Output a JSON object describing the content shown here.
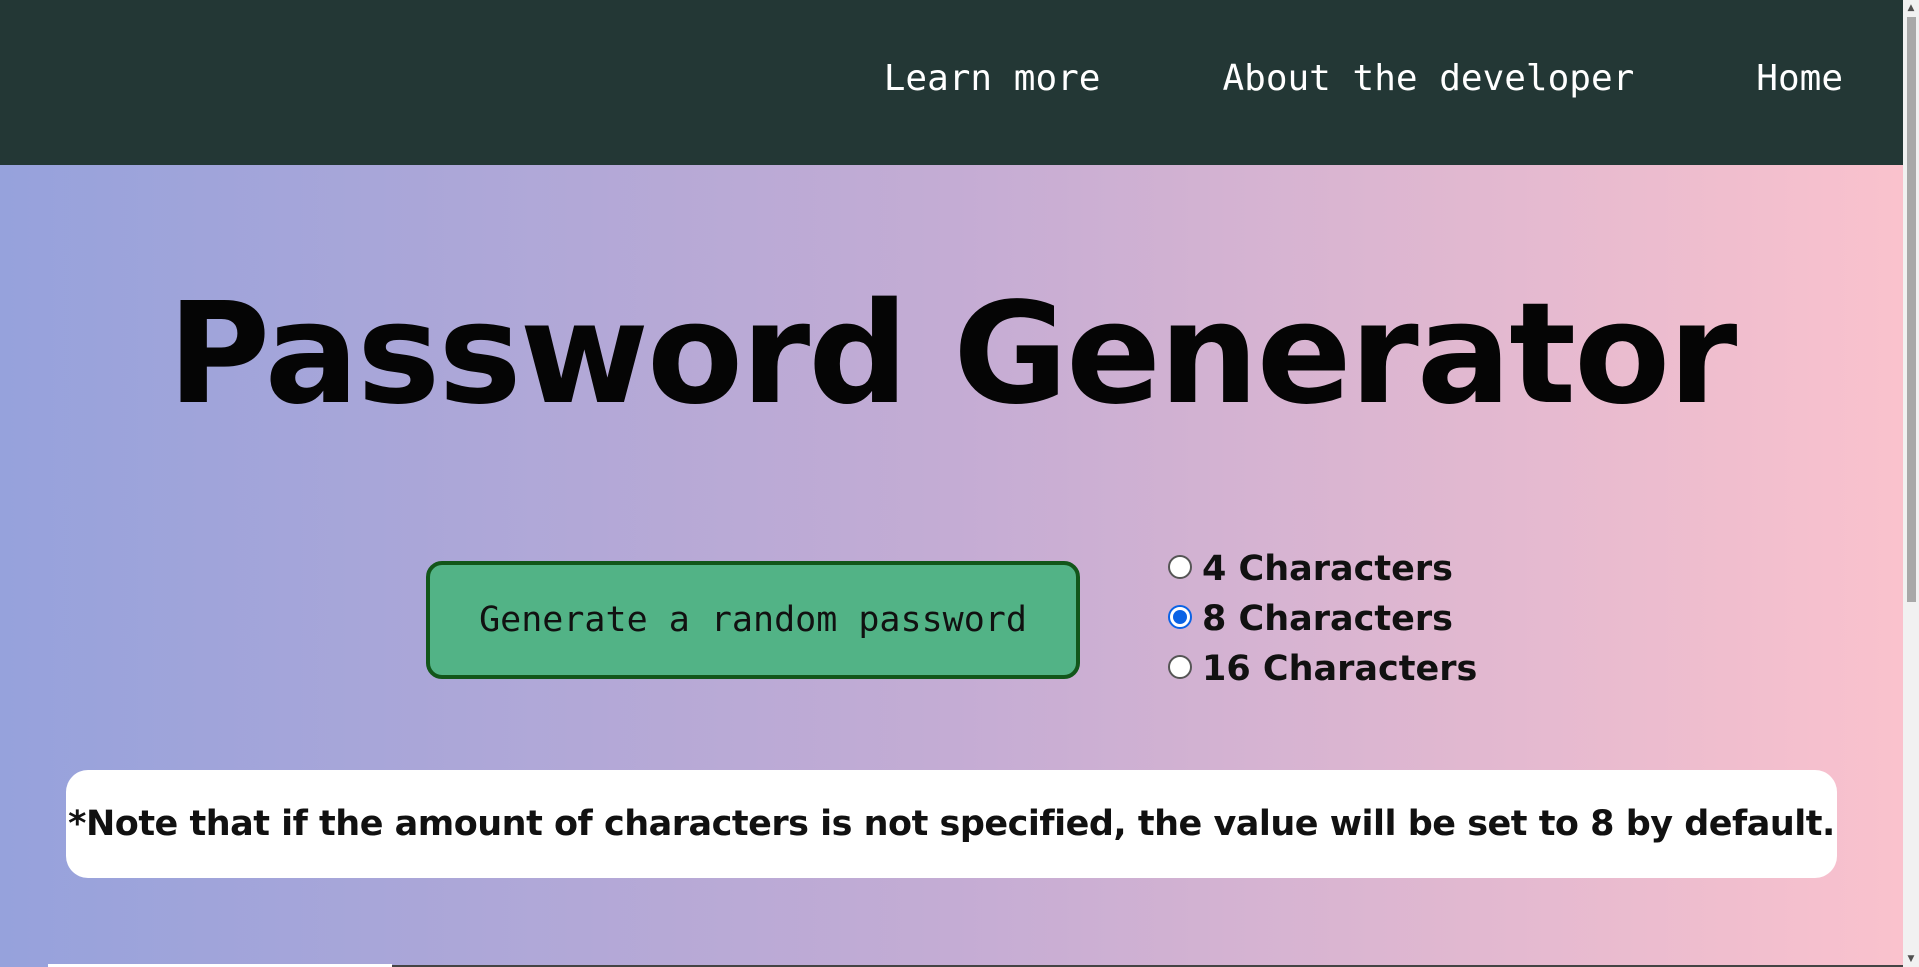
{
  "nav": {
    "items": [
      {
        "label": "Learn more"
      },
      {
        "label": "About the developer"
      },
      {
        "label": "Home"
      }
    ]
  },
  "main": {
    "title": "Password Generator",
    "generate_button_label": "Generate a random password",
    "length_options": [
      {
        "label": "4 Characters",
        "checked": false
      },
      {
        "label": "8 Characters",
        "checked": true
      },
      {
        "label": "16 Characters",
        "checked": false
      }
    ],
    "note": "*Note that if the amount of characters is not specified, the value will be set to 8 by default."
  },
  "colors": {
    "navbar_bg": "#233735",
    "gradient_left": "#96a2dc",
    "gradient_right": "#fac2cd",
    "button_bg": "#52b386",
    "button_border": "#12561a",
    "radio_checked": "#0b63e5"
  },
  "icons": {
    "scroll_up": "▲",
    "scroll_down": "▼"
  }
}
